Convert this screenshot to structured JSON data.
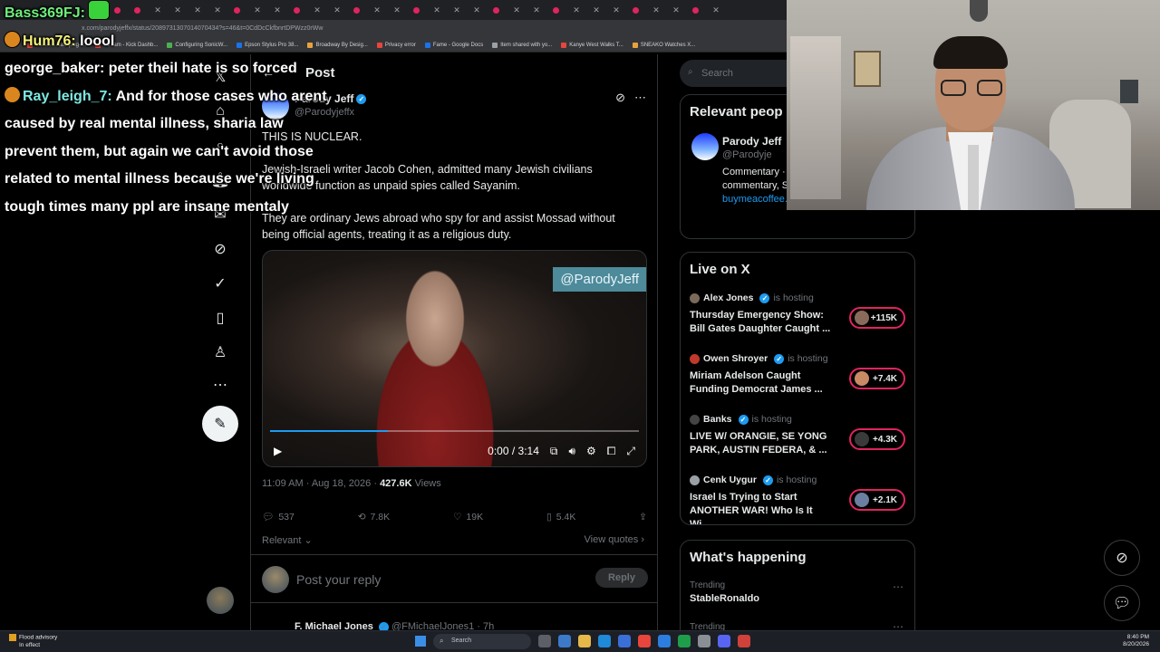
{
  "browser": {
    "url": "x.com/parodyjeffx/status/2089731307014070434?s=46&t=0CdDcCkfbnrtDPWzz0rWw",
    "bookmarks": [
      "Camera Raw plug-i...",
      "Stream - Kick Dashb...",
      "Configuring SonicW...",
      "Epson Stylus Pro 38...",
      "Broadway By Desig...",
      "Privacy error",
      "Fame - Google Docs",
      "Item shared with yo...",
      "Kanye West Walks T...",
      "SNEAKO Watches X..."
    ]
  },
  "chat": [
    {
      "user": "Bass369FJ:",
      "message": "",
      "color": "#6df07c"
    },
    {
      "user": "Hum76:",
      "message": "loool",
      "color": "#f2f27a"
    },
    {
      "user": "george_baker:",
      "message": "peter theil hate is so forced",
      "color": "#ffffff"
    },
    {
      "user": "Ray_leigh_7:",
      "message": "And for those cases who arent caused by real mental illness, sharia law prevent them, but again we can't avoid those related to mental illness because we're living tough times many ppl are insane mentaly",
      "color": "#7de7e1"
    }
  ],
  "post": {
    "header": "Post",
    "author_name": "Parody Jeff",
    "author_handle": "@Parodyjeffx",
    "text_1": "THIS IS NUCLEAR.",
    "text_2": "Jewish-Israeli writer Jacob Cohen, admitted many Jewish civilians worldwide function as unpaid spies called Sayanim.",
    "text_3": "They are ordinary Jews abroad who spy for and assist Mossad without being official agents, treating it as a religious duty.",
    "video_watermark": "@ParodyJeff",
    "video_time": "0:00 / 3:14",
    "video_progress": 0.32,
    "timestamp": "11:09 AM · Aug 18, 2026 ·",
    "views_count": "427.6K",
    "views_label": "Views",
    "replies": "537",
    "reposts": "7.8K",
    "likes": "19K",
    "bookmarks": "5.4K",
    "sort_label": "Relevant",
    "view_quotes": "View quotes",
    "reply_placeholder": "Post your reply",
    "reply_button": "Reply",
    "next_reply_name": "F. Michael Jones",
    "next_reply_handle": "@FMichaelJones1 · 7h"
  },
  "sidebar": {
    "search_placeholder": "Search",
    "relevant_title": "Relevant peop",
    "relevant_name": "Parody Jeff",
    "relevant_handle": "@Parodyje",
    "relevant_bio": "Commentary · content is opi commentary, SUPPORT ME:",
    "relevant_link": "buymeacoffee.com/JeffxE",
    "live_title": "Live on X",
    "live": [
      {
        "host": "Alex Jones",
        "hosting": "is hosting",
        "title": "Thursday Emergency Show: Bill Gates Daughter Caught ...",
        "count": "+115K"
      },
      {
        "host": "Owen Shroyer",
        "hosting": "is hosting",
        "title": "Miriam Adelson Caught Funding Democrat James ...",
        "count": "+7.4K"
      },
      {
        "host": "Banks",
        "hosting": "is hosting",
        "title": "LIVE W/ ORANGIE, SE YONG PARK, AUSTIN FEDERA, & ...",
        "count": "+4.3K"
      },
      {
        "host": "Cenk Uygur",
        "hosting": "is hosting",
        "title": "Israel Is Trying to Start ANOTHER WAR! Who Is It Wi...",
        "count": "+2.1K"
      }
    ],
    "happening_title": "What's happening",
    "trend_1_label": "Trending",
    "trend_1_name": "StableRonaldo",
    "trend_2_label": "Trending"
  },
  "taskbar": {
    "weather_title": "Flood advisory",
    "weather_sub": "In effect",
    "search": "Search",
    "time": "8:40 PM",
    "date": "8/20/2026"
  },
  "colors": {
    "accent": "#1d9bf0",
    "live": "#e0245e",
    "background": "#000000"
  }
}
